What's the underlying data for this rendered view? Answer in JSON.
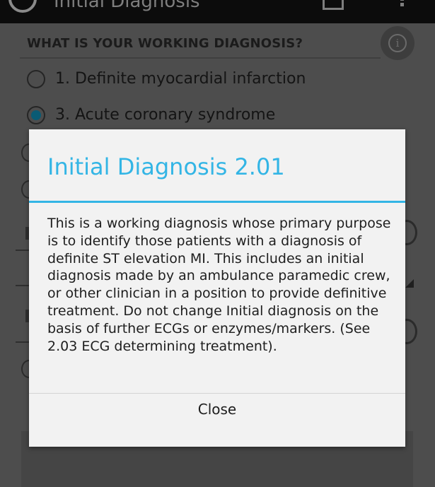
{
  "action_bar": {
    "title": "Initial Diagnosis",
    "back_icon": "back-chevron-icon",
    "app_icon": "app-circle-icon",
    "save_icon": "save-icon",
    "overflow_icon": "overflow-menu-icon"
  },
  "form": {
    "question": "WHAT IS YOUR WORKING DIAGNOSIS?",
    "info_icon": "info-icon",
    "options": [
      {
        "label": "1. Definite myocardial infarction",
        "selected": false
      },
      {
        "label": "3. Acute coronary syndrome",
        "selected": true
      }
    ]
  },
  "dialog": {
    "title": "Initial Diagnosis 2.01",
    "body": "This is a working diagnosis whose primary purpose is to identify those patients with a diagnosis of definite ST elevation MI. This includes an initial diagnosis made by an ambulance paramedic crew, or other clinician in a position to provide definitive treatment. Do not change Initial diagnosis on the basis of further ECGs or enzymes/markers. (See 2.03 ECG determining treatment).",
    "close_label": "Close"
  },
  "colors": {
    "accent": "#33b5e5",
    "selected_radio": "#0a5b74",
    "dialog_background": "#f2f2f2",
    "dim_background": "#4d4d4d"
  }
}
